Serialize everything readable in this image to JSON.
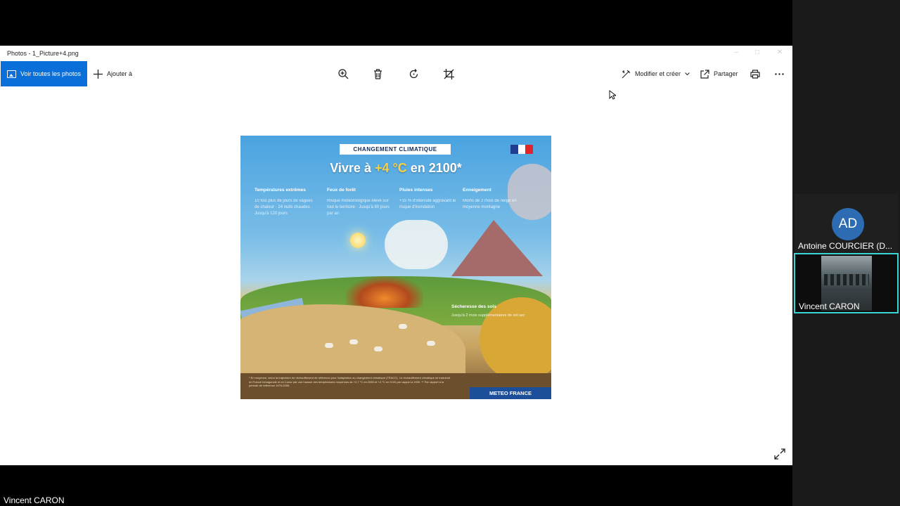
{
  "window": {
    "title": "Photos - 1_Picture+4.png"
  },
  "toolbar": {
    "see_all_label": "Voir toutes les photos",
    "add_label": "Ajouter à",
    "edit_label": "Modifier et créer",
    "share_label": "Partager"
  },
  "poster": {
    "badge": "CHANGEMENT CLIMATIQUE",
    "title_prefix": "Vivre à ",
    "title_highlight": "+4 °C",
    "title_suffix": " en 2100*",
    "columns": [
      {
        "heading": "Températures extrêmes",
        "text": "10 fois plus de jours de vagues de chaleur · 24 nuits chaudes · Jusqu'à 120 jours"
      },
      {
        "heading": "Feux de forêt",
        "text": "Risque météorologique élevé sur tout le territoire · Jusqu'à 80 jours par an"
      },
      {
        "heading": "Pluies intenses",
        "text": "+15 % d'intensité aggravant le risque d'inondation"
      },
      {
        "heading": "Enneigement",
        "text": "Moins de 2 mois de neige en moyenne montagne"
      }
    ],
    "drought_heading": "Sécheresse des sols",
    "drought_text": "Jusqu'à 2 mois supplémentaires de sol sec",
    "footnote": "* En moyenne, selon la trajectoire de réchauffement de référence pour l'adaptation au changement climatique (TRACC). Le réchauffement climatique se traduirait en France hexagonale et en Corse par une hausse des températures moyennes de +2,7 °C en 2050 et +4 °C en 2100 par rapport à 1900. ** Par rapport à la période de référence 1976-2005.",
    "brand": "METEO FRANCE",
    "flag_colors": [
      "#1f3e8f",
      "#ffffff",
      "#e1262b"
    ]
  },
  "participants": [
    {
      "initials": "AD",
      "name": "Antoine COURCIER (D..."
    },
    {
      "name": "Vincent CARON"
    }
  ],
  "presenter_name": "Vincent CARON",
  "colors": {
    "accent": "#0a6fd8",
    "active_speaker": "#3ad6d6",
    "avatar": "#2d6cb2"
  }
}
